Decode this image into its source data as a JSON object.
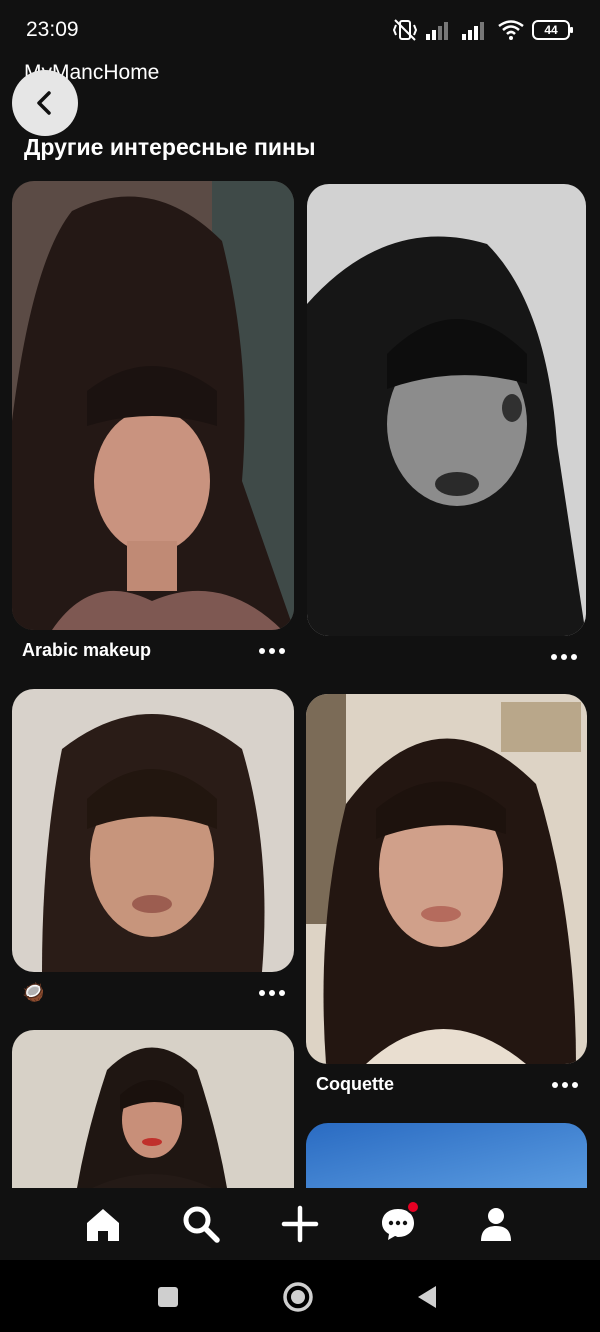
{
  "status_bar": {
    "time": "23:09",
    "battery": "44",
    "icons": [
      "vibrate-off-icon",
      "signal-icon",
      "signal-icon",
      "wifi-icon",
      "battery-icon"
    ]
  },
  "header": {
    "board_name": "MyMancHome",
    "back_icon": "chevron-left-icon"
  },
  "section_title": "Другие интересные пины",
  "pins": [
    {
      "caption": "Arabic makeup",
      "image": "woman with bangs in mauve satin top",
      "colors": [
        "#6b4a44",
        "#2a1d1a",
        "#a57a6b"
      ]
    },
    {
      "caption": "",
      "image": "black and white portrait with bangs and freckles",
      "colors": [
        "#cfcfcf",
        "#151515",
        "#6e6e6e"
      ]
    },
    {
      "caption": "",
      "caption_emoji": "🥥",
      "image": "woman with curtain bangs selfie",
      "colors": [
        "#d9d3cc",
        "#2b1d18",
        "#b98a72"
      ]
    },
    {
      "caption": "Coquette",
      "image": "woman with wavy hair and bangs on balcony",
      "colors": [
        "#dcd2c4",
        "#241713",
        "#c3937c"
      ]
    },
    {
      "caption": "",
      "image": "woman with bangs and red lipstick",
      "colors": [
        "#d8d2c8",
        "#1f1612",
        "#a9705d"
      ]
    },
    {
      "caption": "",
      "image": "blue sky",
      "colors": [
        "#2f74c8",
        "#4a8fdc",
        "#6aa6e6"
      ]
    }
  ],
  "bottom_nav": {
    "items": [
      {
        "icon": "home-icon"
      },
      {
        "icon": "search-icon",
        "active": true
      },
      {
        "icon": "plus-icon"
      },
      {
        "icon": "messages-icon",
        "badge": true
      },
      {
        "icon": "profile-icon"
      }
    ]
  },
  "system_nav": [
    "square-recents-icon",
    "circle-home-icon",
    "triangle-back-icon"
  ],
  "theme": {
    "background": "#111111",
    "notification": "#e60023"
  }
}
